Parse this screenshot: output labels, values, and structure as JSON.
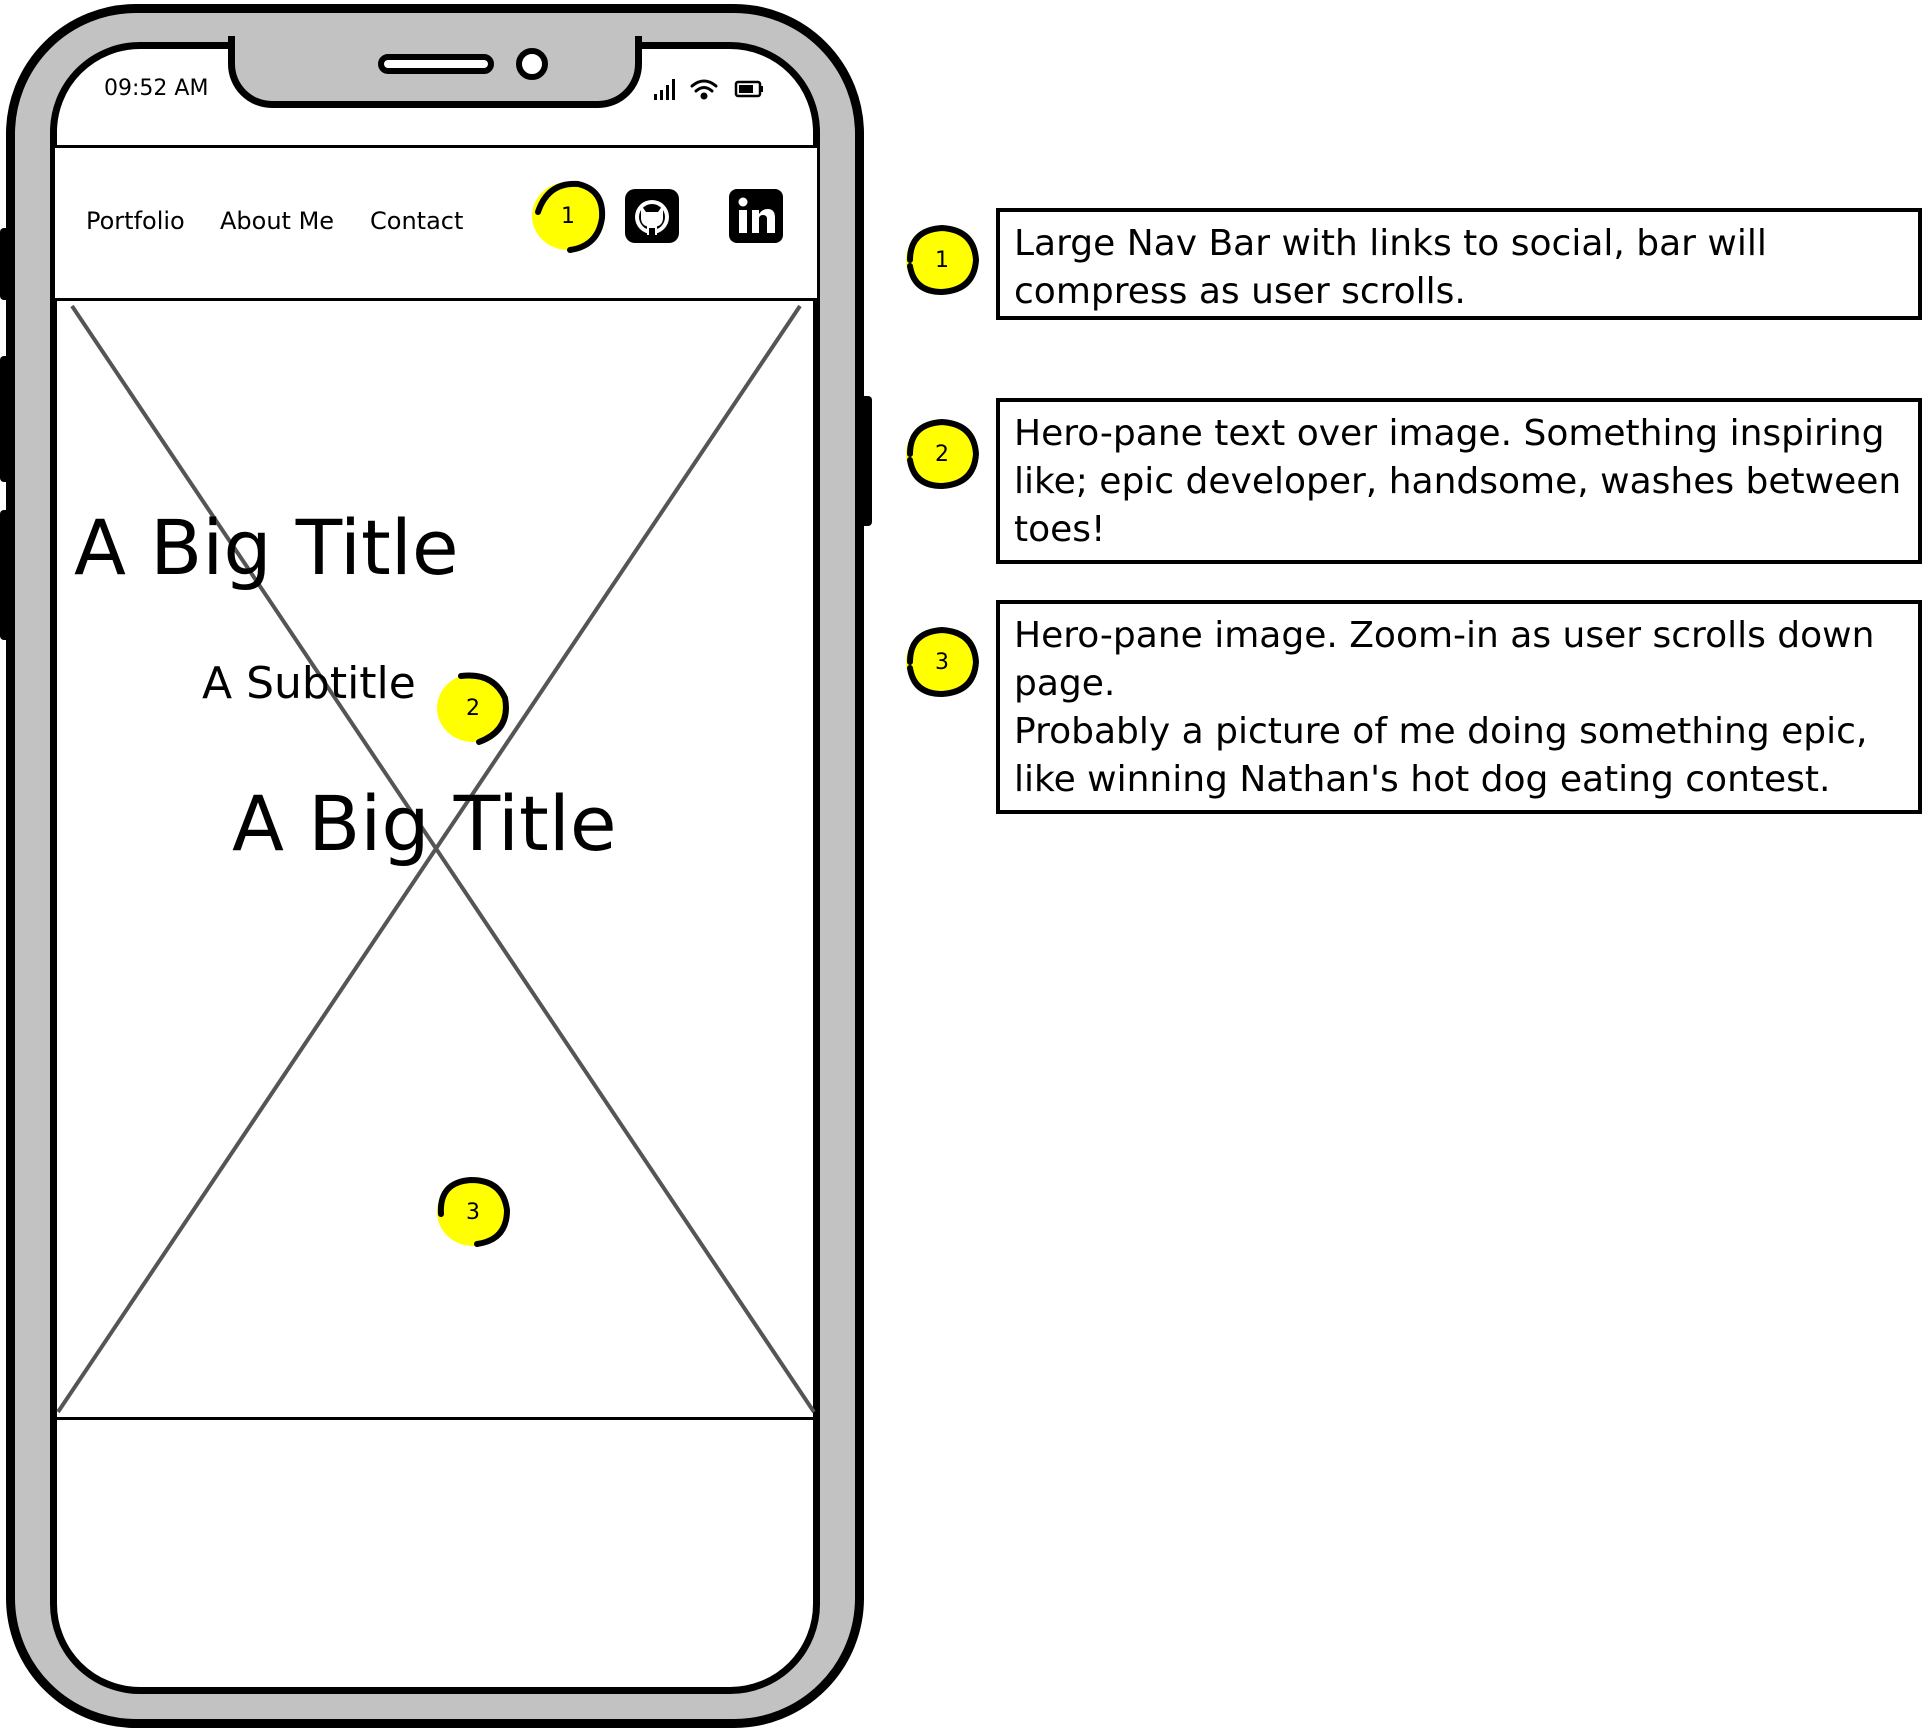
{
  "status_bar": {
    "time": "09:52 AM"
  },
  "nav": {
    "links": [
      "Portfolio",
      "About Me",
      "Contact"
    ],
    "social_icons": [
      "github-icon",
      "linkedin-icon"
    ]
  },
  "hero": {
    "title_top": "A Big Title",
    "subtitle": "A Subtitle",
    "title_bottom": "A Big Title"
  },
  "markers": [
    "1",
    "2",
    "3"
  ],
  "annotations": [
    {
      "number": "1",
      "lines": [
        "Large Nav Bar with links to social, bar will",
        "compress as user scrolls."
      ]
    },
    {
      "number": "2",
      "lines": [
        "Hero-pane text over image. Something inspiring",
        "like; epic developer, handsome, washes between",
        "toes!"
      ]
    },
    {
      "number": "3",
      "lines": [
        "Hero-pane image. Zoom-in as user scrolls down",
        "page.",
        "Probably a picture of me doing something epic,",
        "like winning Nathan's hot dog eating contest."
      ]
    }
  ],
  "colors": {
    "marker": "#ffff00",
    "phone_frame": "#c2c2c2",
    "placeholder_lines": "#555555"
  }
}
